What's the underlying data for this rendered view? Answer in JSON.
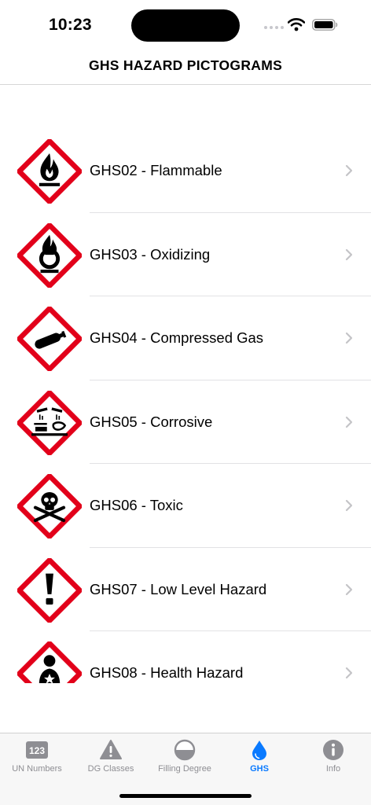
{
  "status_bar": {
    "time": "10:23"
  },
  "nav": {
    "title": "GHS HAZARD PICTOGRAMS"
  },
  "colors": {
    "hazard_red": "#e2001a",
    "accent": "#0a7aff",
    "tab_inactive": "#8e8e93",
    "chevron": "#c4c4c7"
  },
  "list": {
    "items": [
      {
        "label": "GHS02 - Flammable",
        "icon": "flame-pictogram-icon"
      },
      {
        "label": "GHS03 - Oxidizing",
        "icon": "flame-over-circle-pictogram-icon"
      },
      {
        "label": "GHS04 - Compressed Gas",
        "icon": "gas-cylinder-pictogram-icon"
      },
      {
        "label": "GHS05 - Corrosive",
        "icon": "corrosion-pictogram-icon"
      },
      {
        "label": "GHS06 - Toxic",
        "icon": "skull-crossbones-pictogram-icon"
      },
      {
        "label": "GHS07 - Low Level Hazard",
        "icon": "exclamation-mark-pictogram-icon"
      },
      {
        "label": "GHS08 - Health Hazard",
        "icon": "health-hazard-pictogram-icon"
      }
    ]
  },
  "tab_bar": {
    "tabs": [
      {
        "label": "UN Numbers",
        "icon": "un-number-badge-icon",
        "badge": "123",
        "active": false
      },
      {
        "label": "DG Classes",
        "icon": "warning-triangle-icon",
        "active": false
      },
      {
        "label": "Filling Degree",
        "icon": "half-filled-circle-icon",
        "active": false
      },
      {
        "label": "GHS",
        "icon": "drop-icon",
        "active": true
      },
      {
        "label": "Info",
        "icon": "info-icon",
        "active": false
      }
    ]
  }
}
